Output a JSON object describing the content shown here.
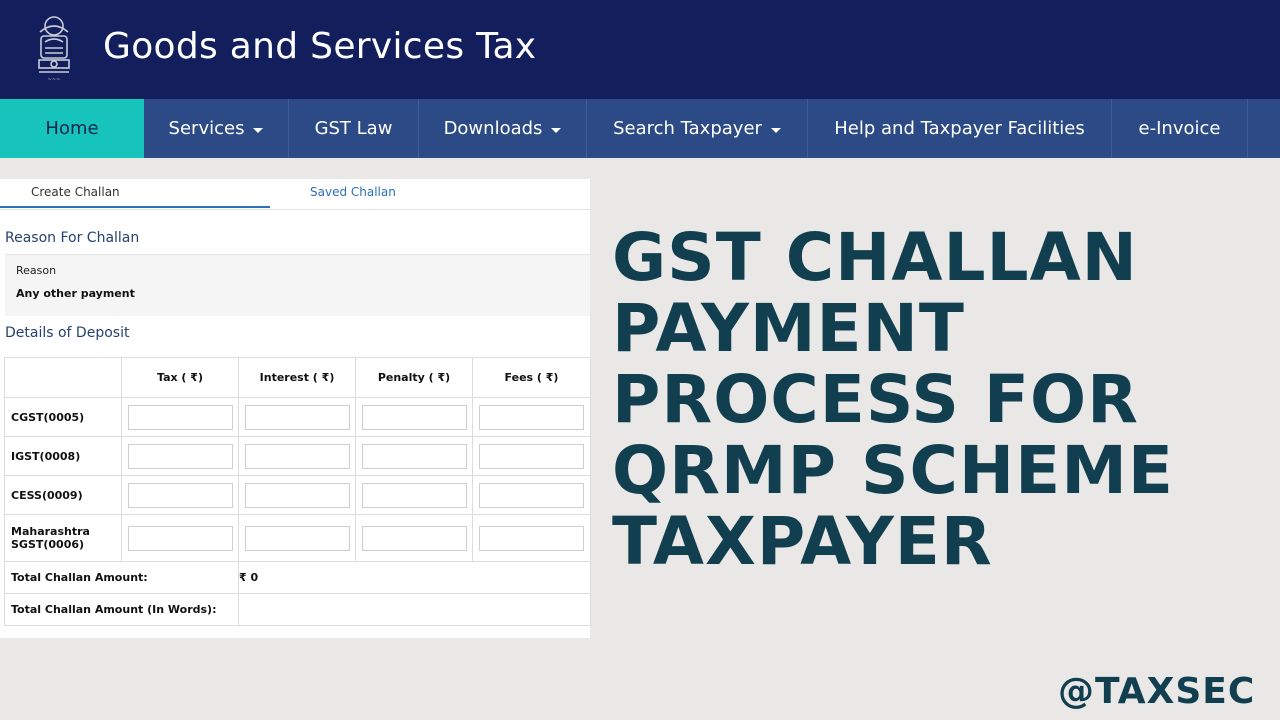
{
  "header": {
    "title": "Goods and Services Tax",
    "emblem_icon": "ashoka-emblem-icon"
  },
  "nav": {
    "items": [
      {
        "label": "Home",
        "active": true,
        "dropdown": false
      },
      {
        "label": "Services",
        "active": false,
        "dropdown": true
      },
      {
        "label": "GST Law",
        "active": false,
        "dropdown": false
      },
      {
        "label": "Downloads",
        "active": false,
        "dropdown": true
      },
      {
        "label": "Search Taxpayer",
        "active": false,
        "dropdown": true
      },
      {
        "label": "Help and Taxpayer Facilities",
        "active": false,
        "dropdown": false
      },
      {
        "label": "e-Invoice",
        "active": false,
        "dropdown": false
      }
    ]
  },
  "tabs": {
    "create": "Create Challan",
    "saved": "Saved Challan"
  },
  "reason_section": {
    "title": "Reason For Challan",
    "label": "Reason",
    "value": "Any other payment"
  },
  "deposit": {
    "title": "Details of Deposit",
    "columns": [
      "Tax ( ₹)",
      "Interest ( ₹)",
      "Penalty ( ₹)",
      "Fees ( ₹)"
    ],
    "rows": [
      "CGST(0005)",
      "IGST(0008)",
      "CESS(0009)",
      "Maharashtra SGST(0006)"
    ],
    "total_label": "Total Challan Amount:",
    "total_value": "₹ 0",
    "words_label": "Total Challan Amount (In Words):"
  },
  "headline": {
    "lines": [
      "GST CHALLAN",
      "PAYMENT",
      "PROCESS FOR",
      "QRMP SCHEME",
      "TAXPAYER"
    ]
  },
  "handle": "@TAXSEC",
  "colors": {
    "header_bg": "#131f5c",
    "nav_bg": "#2c4a85",
    "nav_active": "#17c4bb",
    "headline_text": "#123f4f"
  }
}
